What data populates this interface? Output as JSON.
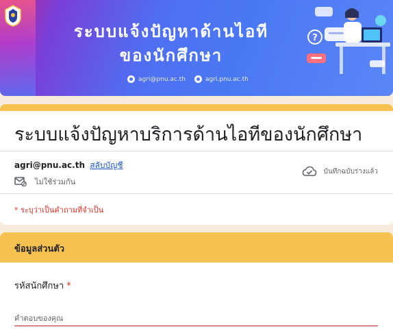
{
  "banner": {
    "title_line1": "ระบบแจ้งปัญหาด้านไอที",
    "title_line2": "ของนักศึกษา",
    "email": "agri@pnu.ac.th",
    "website": "agri.pnu.ac.th"
  },
  "form": {
    "title": "ระบบแจ้งปัญหาบริการด้านไอทีของนักศึกษา",
    "account_email": "agri@pnu.ac.th",
    "switch_account": "สลับบัญชี",
    "not_shared": "ไม่ใช้ร่วมกัน",
    "draft_saved": "บันทึกฉบับร่างแล้ว",
    "required_note": "* ระบุว่าเป็นคำถามที่จำเป็น"
  },
  "section": {
    "title": "ข้อมูลส่วนตัว"
  },
  "question": {
    "label": "รหัสนักศึกษา",
    "required_mark": "*",
    "placeholder": "คำตอบของคุณ"
  },
  "colors": {
    "accent": "#f5c150",
    "page_bg": "#f7ecdc",
    "required": "#d93025",
    "link": "#1a56c7"
  },
  "icons": [
    "university-seal-icon",
    "email-icon",
    "globe-icon",
    "mail-not-shared-icon",
    "cloud-saved-icon",
    "helpdesk-illustration"
  ]
}
